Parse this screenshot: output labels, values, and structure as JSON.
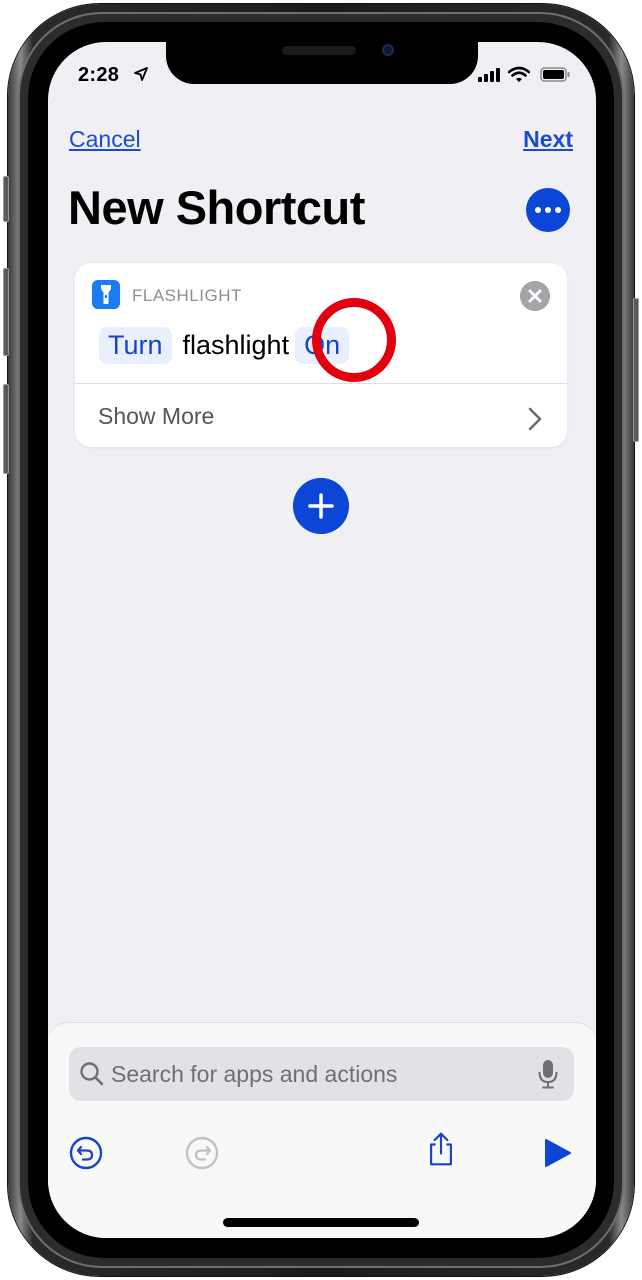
{
  "status_bar": {
    "time": "2:28",
    "location_icon": "location-arrow-icon",
    "signal_icon": "cellular-signal-icon",
    "wifi_icon": "wifi-icon",
    "battery_icon": "battery-icon"
  },
  "nav": {
    "cancel_label": "Cancel",
    "next_label": "Next"
  },
  "header": {
    "title": "New Shortcut",
    "more_icon": "ellipsis-icon"
  },
  "action_card": {
    "app_icon": "flashlight-icon",
    "app_label": "FLASHLIGHT",
    "parameter_token_1": "Turn",
    "static_word": "flashlight",
    "parameter_token_2": "On",
    "show_more_label": "Show More",
    "close_icon": "close-icon",
    "chevron_icon": "chevron-right-icon",
    "annotation": "red-circle-highlight"
  },
  "add_action_icon": "plus-icon",
  "bottom_sheet": {
    "search": {
      "placeholder": "Search for apps and actions",
      "value": ""
    },
    "toolbar": {
      "undo_icon": "undo-icon",
      "redo_icon": "redo-icon",
      "share_icon": "share-icon",
      "run_icon": "play-icon"
    }
  },
  "colors": {
    "accent": "#0b46d6",
    "link": "#1a4bd0",
    "annotation": "#e00010",
    "background": "#efeff4",
    "app_icon": "#1b7cf2"
  }
}
